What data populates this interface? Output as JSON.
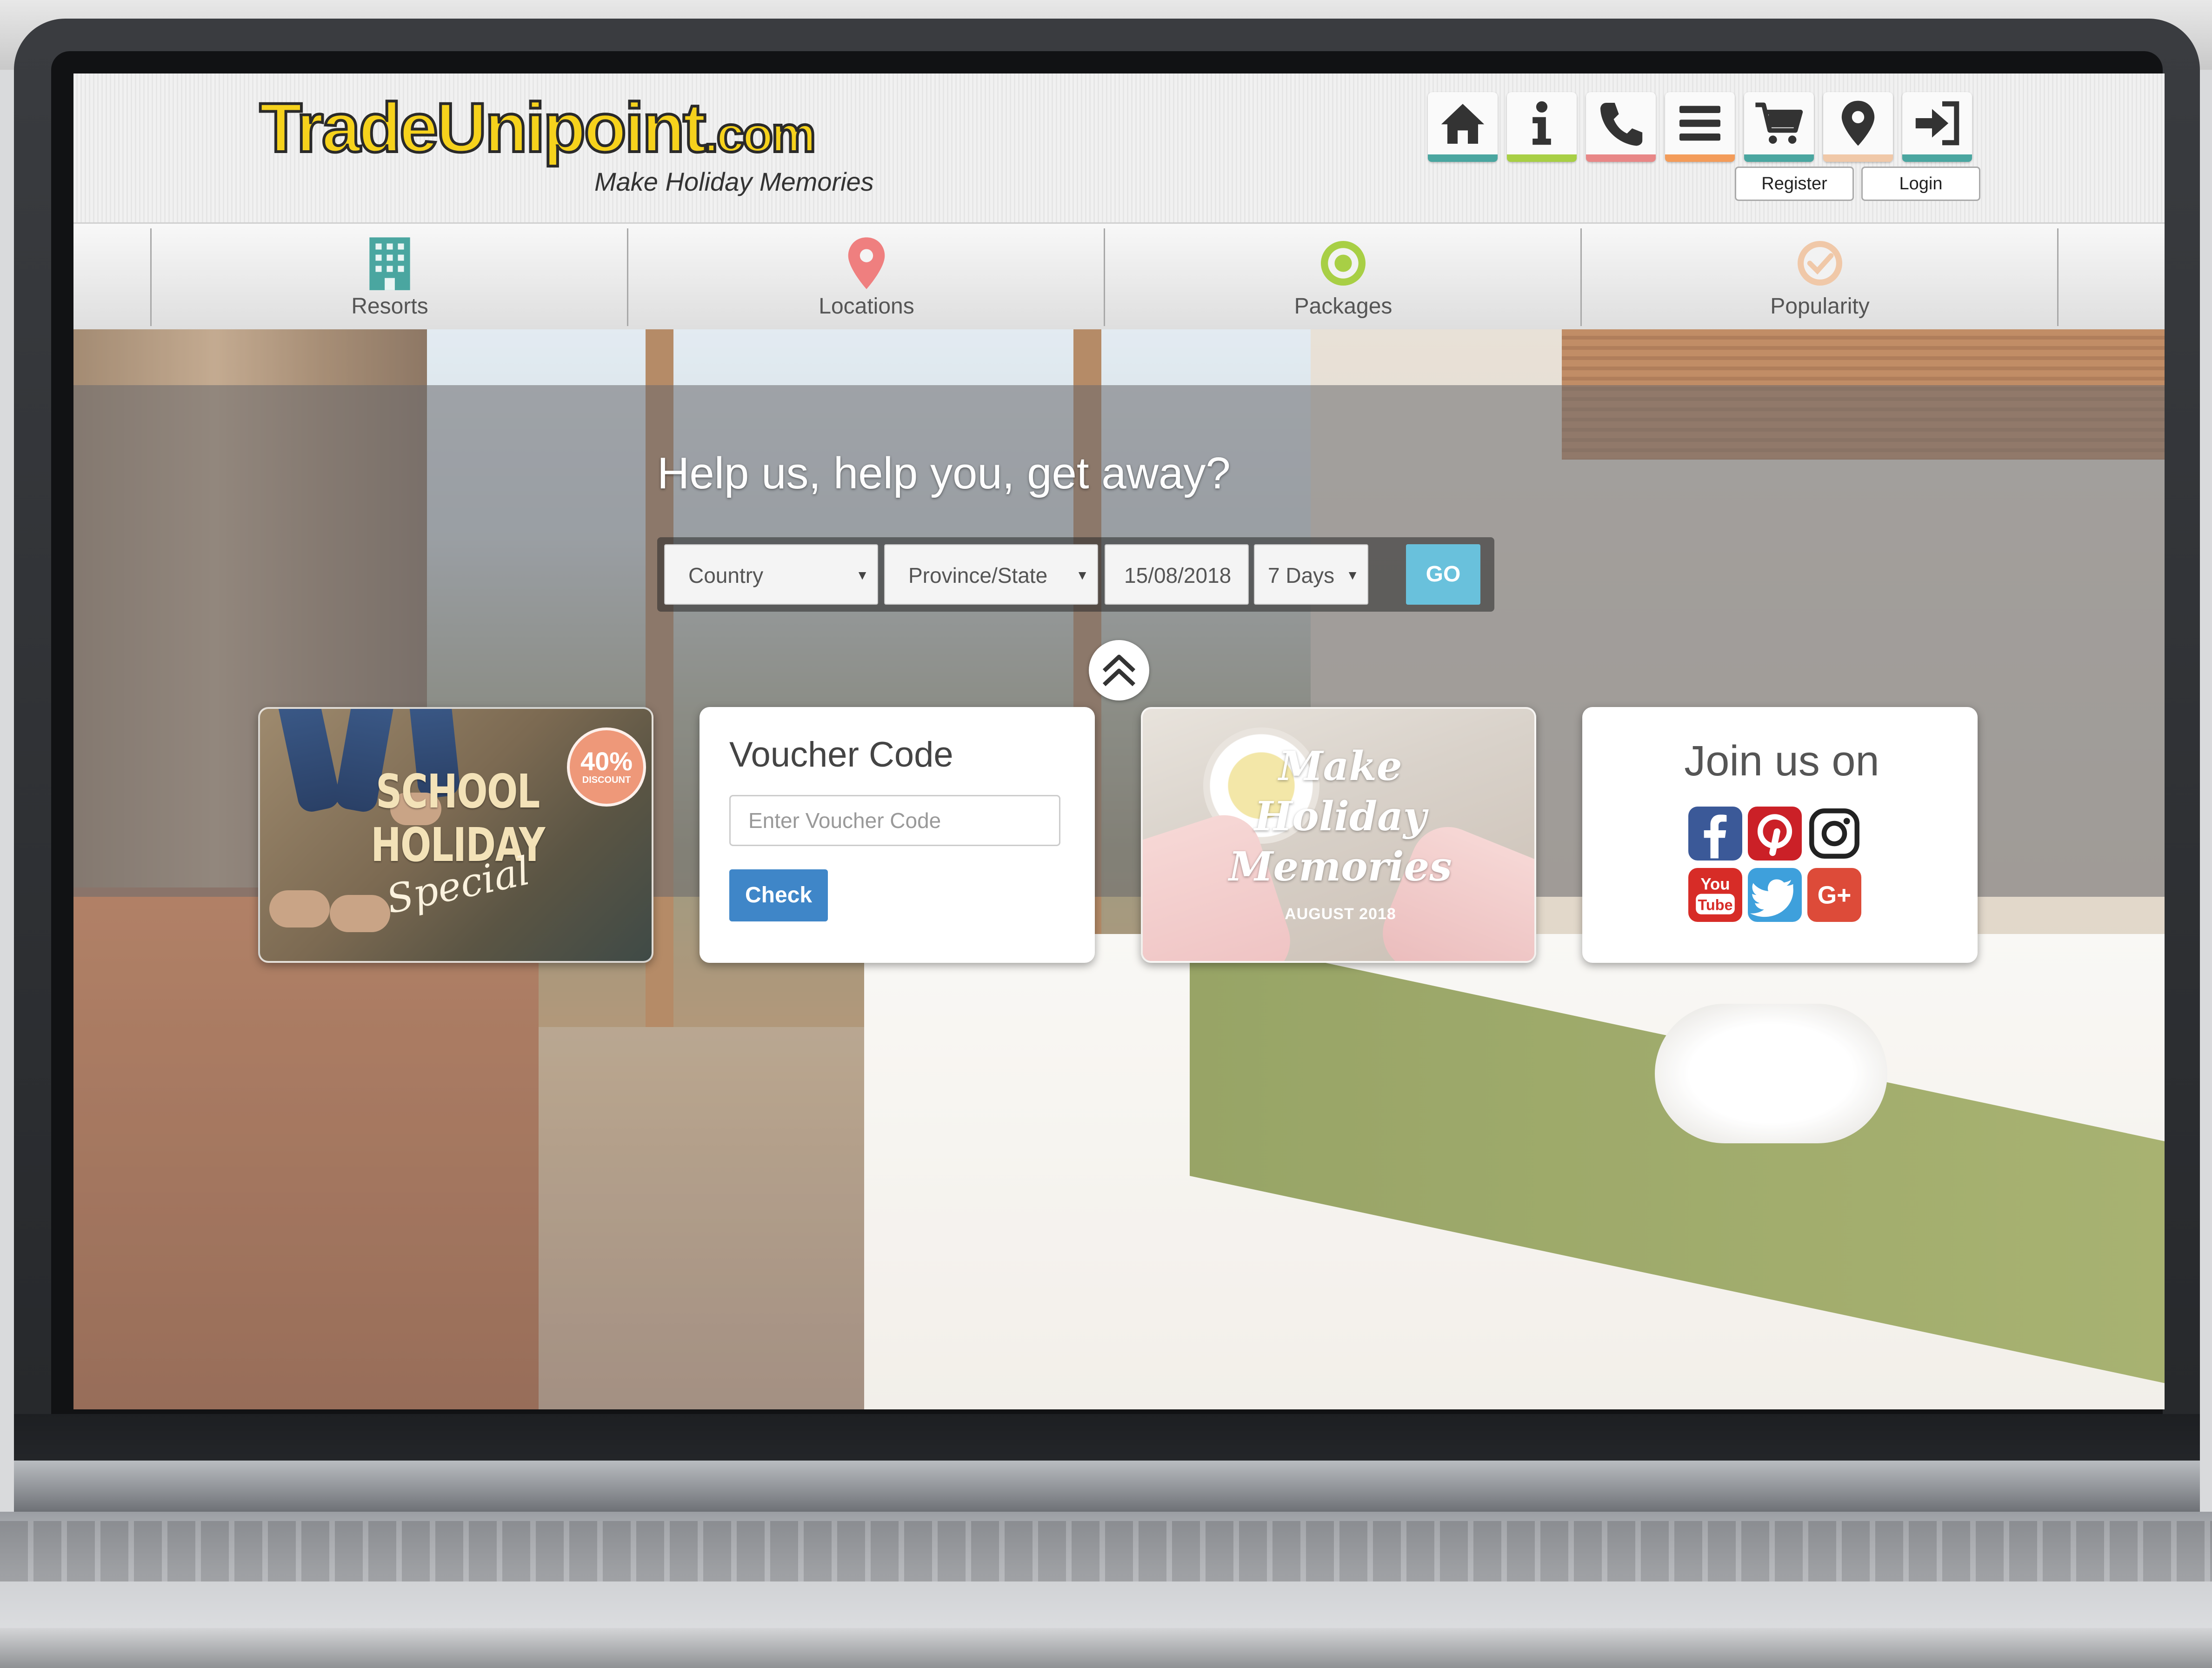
{
  "brand": {
    "logo_main": "TradeUnipoint",
    "logo_suffix": ".com",
    "tagline": "Make Holiday Memories"
  },
  "top_icons": [
    {
      "icon": "home-icon",
      "color": "#4aa6a0"
    },
    {
      "icon": "info-icon",
      "color": "#a8cf45"
    },
    {
      "icon": "phone-icon",
      "color": "#e88787"
    },
    {
      "icon": "menu-icon",
      "color": "#f39c5a"
    },
    {
      "icon": "cart-icon",
      "color": "#4aa6a0"
    },
    {
      "icon": "location-pin-icon",
      "color": "#f0c8a8"
    },
    {
      "icon": "sign-in-icon",
      "color": "#4aa6a0"
    }
  ],
  "auth": {
    "register_label": "Register",
    "login_label": "Login"
  },
  "nav": {
    "items": [
      {
        "label": "Resorts",
        "icon": "building-icon",
        "color": "#4aa6a0"
      },
      {
        "label": "Locations",
        "icon": "location-pin-icon",
        "color": "#ef7f7f"
      },
      {
        "label": "Packages",
        "icon": "target-icon",
        "color": "#a8cf45"
      },
      {
        "label": "Popularity",
        "icon": "check-circle-icon",
        "color": "#f0c8a8"
      }
    ]
  },
  "hero": {
    "title": "Help us, help you, get away?"
  },
  "search": {
    "country": "Country",
    "province": "Province/State",
    "date": "15/08/2018",
    "days": "7 Days",
    "go_label": "GO"
  },
  "promo_school": {
    "line1": "SCHOOL",
    "line2": "HOLIDAY",
    "line3": "Special",
    "badge_value": "40%",
    "badge_label": "DISCOUNT"
  },
  "voucher": {
    "title": "Voucher Code",
    "placeholder": "Enter Voucher Code",
    "check_label": "Check"
  },
  "promo_memories": {
    "line1": "Make",
    "line2": "Holiday",
    "line3": "Memories",
    "date": "AUGUST 2018"
  },
  "social": {
    "title": "Join us on",
    "networks": [
      {
        "icon": "facebook-icon",
        "color": "#3b5998"
      },
      {
        "icon": "pinterest-icon",
        "color": "#cb2027"
      },
      {
        "icon": "instagram-icon",
        "color": "#222222"
      },
      {
        "icon": "youtube-icon",
        "color": "#d72c27",
        "text_top": "You",
        "text_bottom": "Tube"
      },
      {
        "icon": "twitter-icon",
        "color": "#3ea0dc"
      },
      {
        "icon": "google-plus-icon",
        "color": "#dd4b39",
        "text": "G+"
      }
    ]
  },
  "colors": {
    "logo_yellow": "#f6d21c",
    "go_button": "#69c1dc",
    "check_button": "#3f86c8",
    "discount_badge": "#ee9879"
  }
}
